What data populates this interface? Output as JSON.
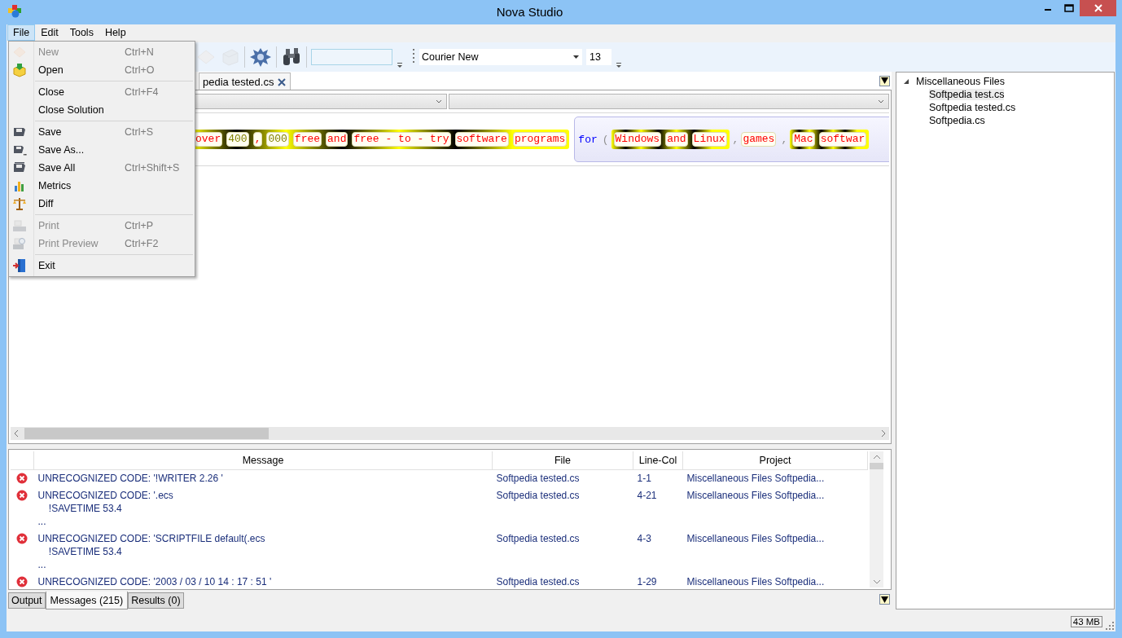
{
  "window": {
    "title": "Nova Studio"
  },
  "menubar": [
    {
      "label": "File",
      "selected": true
    },
    {
      "label": "Edit",
      "selected": false
    },
    {
      "label": "Tools",
      "selected": false
    },
    {
      "label": "Help",
      "selected": false
    }
  ],
  "file_menu": [
    {
      "kind": "item",
      "label": "New",
      "shortcut": "Ctrl+N",
      "disabled": true
    },
    {
      "kind": "item",
      "label": "Open",
      "shortcut": "Ctrl+O",
      "disabled": false
    },
    {
      "kind": "separator"
    },
    {
      "kind": "item",
      "label": "Close",
      "shortcut": "Ctrl+F4",
      "disabled": false
    },
    {
      "kind": "item",
      "label": "Close Solution",
      "disabled": false
    },
    {
      "kind": "separator"
    },
    {
      "kind": "item",
      "label": "Save",
      "shortcut": "Ctrl+S",
      "disabled": false
    },
    {
      "kind": "item",
      "label": "Save As...",
      "disabled": false
    },
    {
      "kind": "item",
      "label": "Save All",
      "shortcut": "Ctrl+Shift+S",
      "disabled": false
    },
    {
      "kind": "item",
      "label": "Metrics",
      "disabled": false
    },
    {
      "kind": "item",
      "label": "Diff",
      "disabled": false
    },
    {
      "kind": "separator"
    },
    {
      "kind": "item",
      "label": "Print",
      "shortcut": "Ctrl+P",
      "disabled": true
    },
    {
      "kind": "item",
      "label": "Print Preview",
      "shortcut": "Ctrl+F2",
      "disabled": true
    },
    {
      "kind": "separator"
    },
    {
      "kind": "item",
      "label": "Exit",
      "disabled": false
    }
  ],
  "toolbar": {
    "font": "Courier New",
    "size": "13"
  },
  "document_tab": {
    "label": "pedia tested.cs",
    "selected": true
  },
  "code": [
    {
      "kind": "band",
      "tokens": [
        {
          "kind": "word",
          "text": "over"
        },
        {
          "kind": "number",
          "text": "400"
        },
        {
          "kind": "word",
          "text": ","
        },
        {
          "kind": "number",
          "text": "000"
        },
        {
          "kind": "word",
          "text": "free"
        },
        {
          "kind": "word",
          "text": "and"
        },
        {
          "kind": "word",
          "text": "free - to - try"
        },
        {
          "kind": "word",
          "text": "software"
        },
        {
          "kind": "word",
          "text": "programs"
        }
      ]
    },
    {
      "kind": "panel",
      "children": [
        {
          "kind": "keyword",
          "text": "for"
        },
        {
          "kind": "punct",
          "text": "("
        },
        {
          "kind": "band",
          "tokens": [
            {
              "kind": "word",
              "text": "Windows"
            },
            {
              "kind": "word",
              "text": "and"
            },
            {
              "kind": "word",
              "text": "Linux"
            }
          ]
        },
        {
          "kind": "punct",
          "text": ","
        },
        {
          "kind": "word",
          "text": "games"
        },
        {
          "kind": "punct",
          "text": ","
        },
        {
          "kind": "band",
          "tokens": [
            {
              "kind": "word",
              "text": "Mac"
            },
            {
              "kind": "word",
              "text": "softwar"
            }
          ]
        }
      ]
    }
  ],
  "messages": {
    "columns": [
      "Message",
      "File",
      "Line-Col",
      "Project"
    ],
    "rows": [
      {
        "message": "UNRECOGNIZED CODE: '!WRITER 2.26 '",
        "file": "Softpedia tested.cs",
        "line_col": "1-1",
        "project": "Miscellaneous Files Softpedia..."
      },
      {
        "message": "UNRECOGNIZED CODE: '.ecs\n    !SAVETIME 53.4\n...",
        "file": "Softpedia tested.cs",
        "line_col": "4-21",
        "project": "Miscellaneous Files Softpedia..."
      },
      {
        "message": "UNRECOGNIZED CODE: 'SCRIPTFILE default(.ecs\n    !SAVETIME 53.4\n...",
        "file": "Softpedia tested.cs",
        "line_col": "4-3",
        "project": "Miscellaneous Files Softpedia..."
      },
      {
        "message": "UNRECOGNIZED CODE: '2003 / 03 / 10 14 : 17 : 51 '",
        "file": "Softpedia tested.cs",
        "line_col": "1-29",
        "project": "Miscellaneous Files Softpedia..."
      }
    ]
  },
  "bottom_tabs": [
    {
      "label": "Output",
      "selected": false
    },
    {
      "label": "Messages (215)",
      "selected": true
    },
    {
      "label": "Results (0)",
      "selected": false
    }
  ],
  "tree": [
    {
      "label": "Miscellaneous Files",
      "expanded": true,
      "children": [
        {
          "label": "Softpedia test.cs",
          "selected": true
        },
        {
          "label": "Softpedia tested.cs",
          "selected": false
        },
        {
          "label": "Softpedia.cs",
          "selected": false
        }
      ]
    }
  ],
  "status_bar": {
    "memory": "43 MB"
  }
}
